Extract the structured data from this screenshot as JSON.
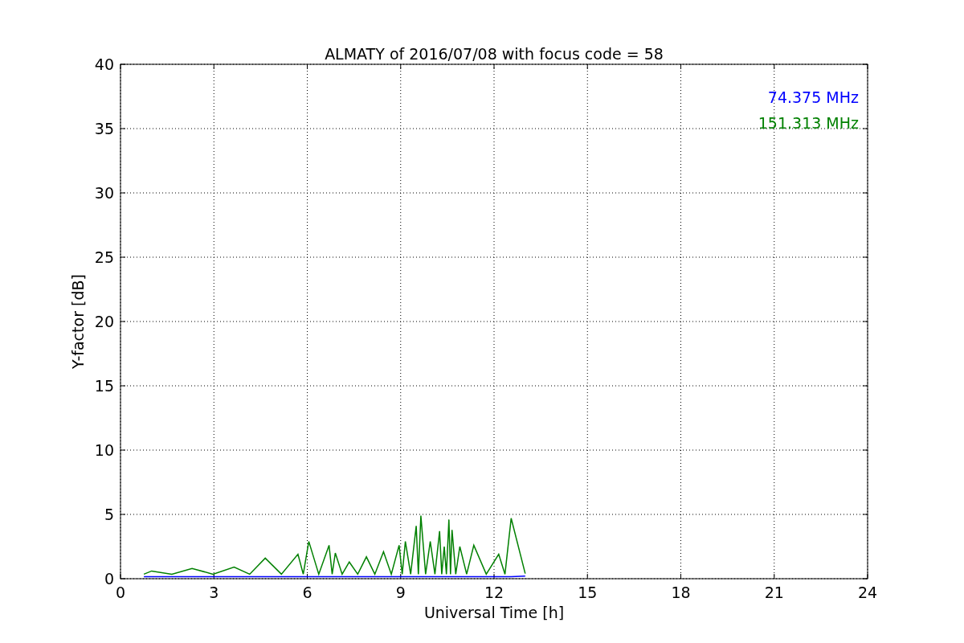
{
  "chart_data": {
    "type": "line",
    "title": "ALMATY of 2016/07/08 with focus code = 58",
    "xlabel": "Universal Time [h]",
    "ylabel": "Y-factor [dB]",
    "grid": true,
    "xlim": [
      0,
      24
    ],
    "ylim": [
      0,
      40
    ],
    "xticks": [
      0,
      3,
      6,
      9,
      12,
      15,
      18,
      21,
      24
    ],
    "yticks": [
      0,
      5,
      10,
      15,
      20,
      25,
      30,
      35,
      40
    ],
    "x": [
      0.75,
      1.0,
      1.65,
      2.3,
      2.97,
      3.65,
      4.15,
      4.65,
      5.17,
      5.7,
      5.87,
      6.05,
      6.37,
      6.7,
      6.8,
      6.9,
      7.12,
      7.35,
      7.62,
      7.9,
      8.17,
      8.45,
      8.7,
      8.95,
      9.05,
      9.15,
      9.32,
      9.5,
      9.57,
      9.65,
      9.8,
      9.95,
      10.1,
      10.25,
      10.32,
      10.4,
      10.47,
      10.55,
      10.6,
      10.65,
      10.77,
      10.9,
      11.12,
      11.35,
      11.75,
      12.15,
      12.35,
      12.55,
      13.0
    ],
    "series": [
      {
        "name": "74.375 MHz",
        "color": "#0000ff",
        "values": [
          0.15,
          0.15,
          0.15,
          0.15,
          0.15,
          0.15,
          0.15,
          0.15,
          0.15,
          0.15,
          0.15,
          0.15,
          0.15,
          0.15,
          0.15,
          0.15,
          0.15,
          0.15,
          0.15,
          0.15,
          0.15,
          0.15,
          0.15,
          0.15,
          0.15,
          0.15,
          0.15,
          0.15,
          0.15,
          0.15,
          0.15,
          0.15,
          0.15,
          0.15,
          0.15,
          0.15,
          0.15,
          0.15,
          0.15,
          0.15,
          0.15,
          0.15,
          0.15,
          0.15,
          0.15,
          0.15,
          0.15,
          0.15,
          0.2
        ]
      },
      {
        "name": "151.313 MHz",
        "color": "#008000",
        "values": [
          0.35,
          0.6,
          0.35,
          0.8,
          0.35,
          0.9,
          0.35,
          1.6,
          0.35,
          1.9,
          0.35,
          2.9,
          0.35,
          2.6,
          0.35,
          2.0,
          0.35,
          1.3,
          0.35,
          1.7,
          0.35,
          2.1,
          0.35,
          2.6,
          0.35,
          2.9,
          0.35,
          4.1,
          0.35,
          4.9,
          0.35,
          2.9,
          0.35,
          3.7,
          0.35,
          2.5,
          0.35,
          4.6,
          0.35,
          3.8,
          0.35,
          2.5,
          0.35,
          2.6,
          0.35,
          1.9,
          0.35,
          4.7,
          0.4
        ]
      }
    ]
  }
}
